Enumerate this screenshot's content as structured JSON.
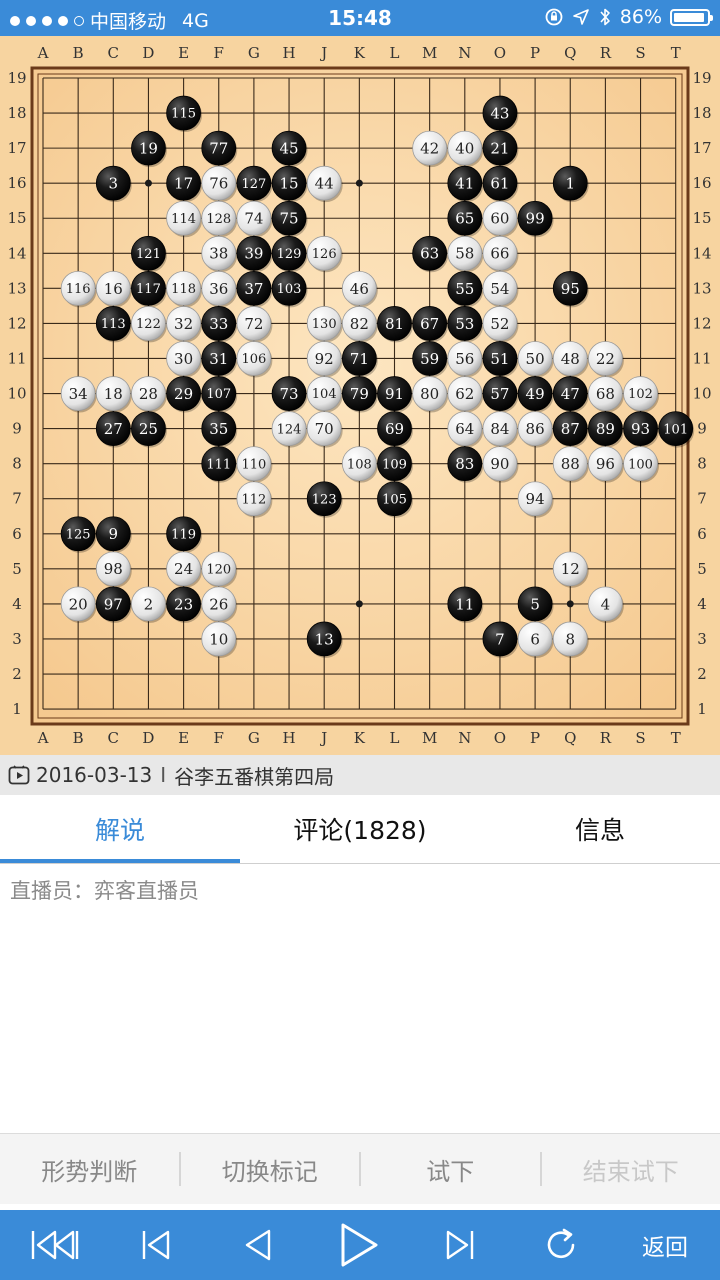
{
  "status": {
    "carrier": "中国移动",
    "network": "4G",
    "time": "15:48",
    "battery": "86%"
  },
  "board": {
    "columns": [
      "A",
      "B",
      "C",
      "D",
      "E",
      "F",
      "G",
      "H",
      "J",
      "K",
      "L",
      "M",
      "N",
      "O",
      "P",
      "Q",
      "R",
      "S",
      "T"
    ],
    "rows": [
      "19",
      "18",
      "17",
      "16",
      "15",
      "14",
      "13",
      "12",
      "11",
      "10",
      "9",
      "8",
      "7",
      "6",
      "5",
      "4",
      "3",
      "2",
      "1"
    ],
    "stones": [
      {
        "c": "E",
        "r": 18,
        "n": "115",
        "b": 1
      },
      {
        "c": "O",
        "r": 18,
        "n": "43",
        "b": 1
      },
      {
        "c": "D",
        "r": 17,
        "n": "19",
        "b": 1
      },
      {
        "c": "F",
        "r": 17,
        "n": "77",
        "b": 1
      },
      {
        "c": "H",
        "r": 17,
        "n": "45",
        "b": 1
      },
      {
        "c": "M",
        "r": 17,
        "n": "42",
        "b": 0
      },
      {
        "c": "N",
        "r": 17,
        "n": "40",
        "b": 0
      },
      {
        "c": "O",
        "r": 17,
        "n": "21",
        "b": 1
      },
      {
        "c": "C",
        "r": 16,
        "n": "3",
        "b": 1
      },
      {
        "c": "E",
        "r": 16,
        "n": "17",
        "b": 1
      },
      {
        "c": "F",
        "r": 16,
        "n": "76",
        "b": 0
      },
      {
        "c": "G",
        "r": 16,
        "n": "127",
        "b": 1
      },
      {
        "c": "H",
        "r": 16,
        "n": "15",
        "b": 1
      },
      {
        "c": "J",
        "r": 16,
        "n": "44",
        "b": 0
      },
      {
        "c": "N",
        "r": 16,
        "n": "41",
        "b": 1
      },
      {
        "c": "O",
        "r": 16,
        "n": "61",
        "b": 1
      },
      {
        "c": "Q",
        "r": 16,
        "n": "1",
        "b": 1
      },
      {
        "c": "E",
        "r": 15,
        "n": "114",
        "b": 0
      },
      {
        "c": "F",
        "r": 15,
        "n": "128",
        "b": 0
      },
      {
        "c": "G",
        "r": 15,
        "n": "74",
        "b": 0
      },
      {
        "c": "H",
        "r": 15,
        "n": "75",
        "b": 1
      },
      {
        "c": "N",
        "r": 15,
        "n": "65",
        "b": 1
      },
      {
        "c": "O",
        "r": 15,
        "n": "60",
        "b": 0
      },
      {
        "c": "P",
        "r": 15,
        "n": "99",
        "b": 1
      },
      {
        "c": "D",
        "r": 14,
        "n": "121",
        "b": 1
      },
      {
        "c": "F",
        "r": 14,
        "n": "38",
        "b": 0
      },
      {
        "c": "G",
        "r": 14,
        "n": "39",
        "b": 1
      },
      {
        "c": "H",
        "r": 14,
        "n": "129",
        "b": 1
      },
      {
        "c": "J",
        "r": 14,
        "n": "126",
        "b": 0
      },
      {
        "c": "M",
        "r": 14,
        "n": "63",
        "b": 1
      },
      {
        "c": "N",
        "r": 14,
        "n": "58",
        "b": 0
      },
      {
        "c": "O",
        "r": 14,
        "n": "66",
        "b": 0
      },
      {
        "c": "B",
        "r": 13,
        "n": "116",
        "b": 0
      },
      {
        "c": "C",
        "r": 13,
        "n": "16",
        "b": 0
      },
      {
        "c": "D",
        "r": 13,
        "n": "117",
        "b": 1
      },
      {
        "c": "E",
        "r": 13,
        "n": "118",
        "b": 0
      },
      {
        "c": "F",
        "r": 13,
        "n": "36",
        "b": 0
      },
      {
        "c": "G",
        "r": 13,
        "n": "37",
        "b": 1
      },
      {
        "c": "H",
        "r": 13,
        "n": "103",
        "b": 1
      },
      {
        "c": "K",
        "r": 13,
        "n": "46",
        "b": 0
      },
      {
        "c": "N",
        "r": 13,
        "n": "55",
        "b": 1
      },
      {
        "c": "O",
        "r": 13,
        "n": "54",
        "b": 0
      },
      {
        "c": "Q",
        "r": 13,
        "n": "95",
        "b": 1
      },
      {
        "c": "C",
        "r": 12,
        "n": "113",
        "b": 1
      },
      {
        "c": "D",
        "r": 12,
        "n": "122",
        "b": 0
      },
      {
        "c": "E",
        "r": 12,
        "n": "32",
        "b": 0
      },
      {
        "c": "F",
        "r": 12,
        "n": "33",
        "b": 1
      },
      {
        "c": "G",
        "r": 12,
        "n": "72",
        "b": 0
      },
      {
        "c": "J",
        "r": 12,
        "n": "130",
        "b": 0
      },
      {
        "c": "K",
        "r": 12,
        "n": "82",
        "b": 0
      },
      {
        "c": "L",
        "r": 12,
        "n": "81",
        "b": 1
      },
      {
        "c": "M",
        "r": 12,
        "n": "67",
        "b": 1
      },
      {
        "c": "N",
        "r": 12,
        "n": "53",
        "b": 1
      },
      {
        "c": "O",
        "r": 12,
        "n": "52",
        "b": 0
      },
      {
        "c": "E",
        "r": 11,
        "n": "30",
        "b": 0
      },
      {
        "c": "F",
        "r": 11,
        "n": "31",
        "b": 1
      },
      {
        "c": "G",
        "r": 11,
        "n": "106",
        "b": 0
      },
      {
        "c": "J",
        "r": 11,
        "n": "92",
        "b": 0
      },
      {
        "c": "K",
        "r": 11,
        "n": "71",
        "b": 1
      },
      {
        "c": "M",
        "r": 11,
        "n": "59",
        "b": 1
      },
      {
        "c": "N",
        "r": 11,
        "n": "56",
        "b": 0
      },
      {
        "c": "O",
        "r": 11,
        "n": "51",
        "b": 1
      },
      {
        "c": "P",
        "r": 11,
        "n": "50",
        "b": 0
      },
      {
        "c": "Q",
        "r": 11,
        "n": "48",
        "b": 0
      },
      {
        "c": "R",
        "r": 11,
        "n": "22",
        "b": 0
      },
      {
        "c": "B",
        "r": 10,
        "n": "34",
        "b": 0
      },
      {
        "c": "C",
        "r": 10,
        "n": "18",
        "b": 0
      },
      {
        "c": "D",
        "r": 10,
        "n": "28",
        "b": 0
      },
      {
        "c": "E",
        "r": 10,
        "n": "29",
        "b": 1
      },
      {
        "c": "F",
        "r": 10,
        "n": "107",
        "b": 1
      },
      {
        "c": "H",
        "r": 10,
        "n": "73",
        "b": 1
      },
      {
        "c": "J",
        "r": 10,
        "n": "104",
        "b": 0
      },
      {
        "c": "K",
        "r": 10,
        "n": "79",
        "b": 1
      },
      {
        "c": "L",
        "r": 10,
        "n": "91",
        "b": 1
      },
      {
        "c": "M",
        "r": 10,
        "n": "80",
        "b": 0
      },
      {
        "c": "N",
        "r": 10,
        "n": "62",
        "b": 0
      },
      {
        "c": "O",
        "r": 10,
        "n": "57",
        "b": 1
      },
      {
        "c": "P",
        "r": 10,
        "n": "49",
        "b": 1
      },
      {
        "c": "Q",
        "r": 10,
        "n": "47",
        "b": 1
      },
      {
        "c": "R",
        "r": 10,
        "n": "68",
        "b": 0
      },
      {
        "c": "S",
        "r": 10,
        "n": "102",
        "b": 0
      },
      {
        "c": "C",
        "r": 9,
        "n": "27",
        "b": 1
      },
      {
        "c": "D",
        "r": 9,
        "n": "25",
        "b": 1
      },
      {
        "c": "F",
        "r": 9,
        "n": "35",
        "b": 1
      },
      {
        "c": "H",
        "r": 9,
        "n": "124",
        "b": 0
      },
      {
        "c": "J",
        "r": 9,
        "n": "70",
        "b": 0
      },
      {
        "c": "L",
        "r": 9,
        "n": "69",
        "b": 1
      },
      {
        "c": "N",
        "r": 9,
        "n": "64",
        "b": 0
      },
      {
        "c": "O",
        "r": 9,
        "n": "84",
        "b": 0
      },
      {
        "c": "P",
        "r": 9,
        "n": "86",
        "b": 0
      },
      {
        "c": "Q",
        "r": 9,
        "n": "87",
        "b": 1
      },
      {
        "c": "R",
        "r": 9,
        "n": "89",
        "b": 1
      },
      {
        "c": "S",
        "r": 9,
        "n": "93",
        "b": 1
      },
      {
        "c": "T",
        "r": 9,
        "n": "101",
        "b": 1
      },
      {
        "c": "F",
        "r": 8,
        "n": "111",
        "b": 1
      },
      {
        "c": "G",
        "r": 8,
        "n": "110",
        "b": 0
      },
      {
        "c": "K",
        "r": 8,
        "n": "108",
        "b": 0
      },
      {
        "c": "L",
        "r": 8,
        "n": "109",
        "b": 1
      },
      {
        "c": "N",
        "r": 8,
        "n": "83",
        "b": 1
      },
      {
        "c": "O",
        "r": 8,
        "n": "90",
        "b": 0
      },
      {
        "c": "Q",
        "r": 8,
        "n": "88",
        "b": 0
      },
      {
        "c": "R",
        "r": 8,
        "n": "96",
        "b": 0
      },
      {
        "c": "S",
        "r": 8,
        "n": "100",
        "b": 0
      },
      {
        "c": "G",
        "r": 7,
        "n": "112",
        "b": 0
      },
      {
        "c": "J",
        "r": 7,
        "n": "123",
        "b": 1
      },
      {
        "c": "L",
        "r": 7,
        "n": "105",
        "b": 1
      },
      {
        "c": "P",
        "r": 7,
        "n": "94",
        "b": 0
      },
      {
        "c": "B",
        "r": 6,
        "n": "125",
        "b": 1
      },
      {
        "c": "C",
        "r": 6,
        "n": "9",
        "b": 1
      },
      {
        "c": "E",
        "r": 6,
        "n": "119",
        "b": 1
      },
      {
        "c": "C",
        "r": 5,
        "n": "98",
        "b": 0
      },
      {
        "c": "E",
        "r": 5,
        "n": "24",
        "b": 0
      },
      {
        "c": "F",
        "r": 5,
        "n": "120",
        "b": 0
      },
      {
        "c": "Q",
        "r": 5,
        "n": "12",
        "b": 0
      },
      {
        "c": "B",
        "r": 4,
        "n": "20",
        "b": 0
      },
      {
        "c": "C",
        "r": 4,
        "n": "97",
        "b": 1
      },
      {
        "c": "D",
        "r": 4,
        "n": "2",
        "b": 0
      },
      {
        "c": "E",
        "r": 4,
        "n": "23",
        "b": 1
      },
      {
        "c": "F",
        "r": 4,
        "n": "26",
        "b": 0
      },
      {
        "c": "N",
        "r": 4,
        "n": "11",
        "b": 1
      },
      {
        "c": "P",
        "r": 4,
        "n": "5",
        "b": 1
      },
      {
        "c": "R",
        "r": 4,
        "n": "4",
        "b": 0
      },
      {
        "c": "F",
        "r": 3,
        "n": "10",
        "b": 0
      },
      {
        "c": "J",
        "r": 3,
        "n": "13",
        "b": 1
      },
      {
        "c": "O",
        "r": 3,
        "n": "7",
        "b": 1
      },
      {
        "c": "P",
        "r": 3,
        "n": "6",
        "b": 0
      },
      {
        "c": "Q",
        "r": 3,
        "n": "8",
        "b": 0
      }
    ],
    "star_points": [
      [
        "D",
        16
      ],
      [
        "K",
        16
      ],
      [
        "K",
        4
      ],
      [
        "Q",
        4
      ]
    ]
  },
  "game": {
    "date": "2016-03-13",
    "separator": "I",
    "title": "谷李五番棋第四局"
  },
  "tabs": [
    {
      "label": "解说",
      "active": true
    },
    {
      "label": "评论(1828)",
      "active": false
    },
    {
      "label": "信息",
      "active": false
    }
  ],
  "commentary": {
    "broadcaster": "直播员：弈客直播员"
  },
  "toolbar": {
    "situation": "形势判断",
    "toggle_marks": "切换标记",
    "try_move": "试下",
    "end_try": "结束试下"
  },
  "nav": {
    "back_label": "返回"
  },
  "colors": {
    "accent": "#3a8bd8",
    "board": "#f7d4a0"
  }
}
